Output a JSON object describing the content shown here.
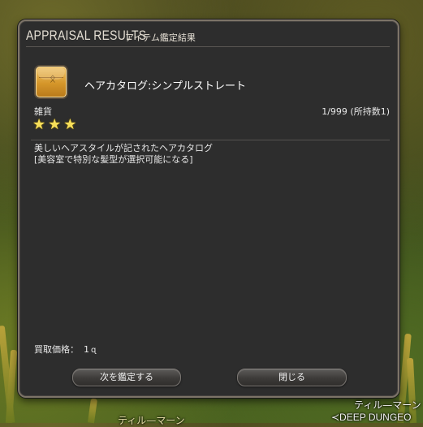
{
  "window": {
    "title_en": "APPRAISAL RESULTS",
    "title_jp": "アイテム鑑定結果"
  },
  "item": {
    "icon": "item-bag-icon",
    "name": "ヘアカタログ:シンプルストレート",
    "category": "雑貨",
    "quantity": "1/999 (所持数1)",
    "stars": 3,
    "description_line1": "美しいヘアスタイルが記されたヘアカタログ",
    "description_line2": "[美容室で特別な髪型が選択可能になる]",
    "price_label": "買取価格：",
    "price_value": "1"
  },
  "buttons": {
    "next_label": "次を鑑定する",
    "close_label": "閉じる"
  },
  "overlay": {
    "label1": "ティル—マーン",
    "label2": "≺DEEP DUNGEO",
    "label3": "ティル—マーン"
  },
  "colors": {
    "window_bg": "#2d2d2d",
    "window_border": "#7d7468",
    "star": "#f7df5a",
    "text": "#e8e8e8"
  }
}
